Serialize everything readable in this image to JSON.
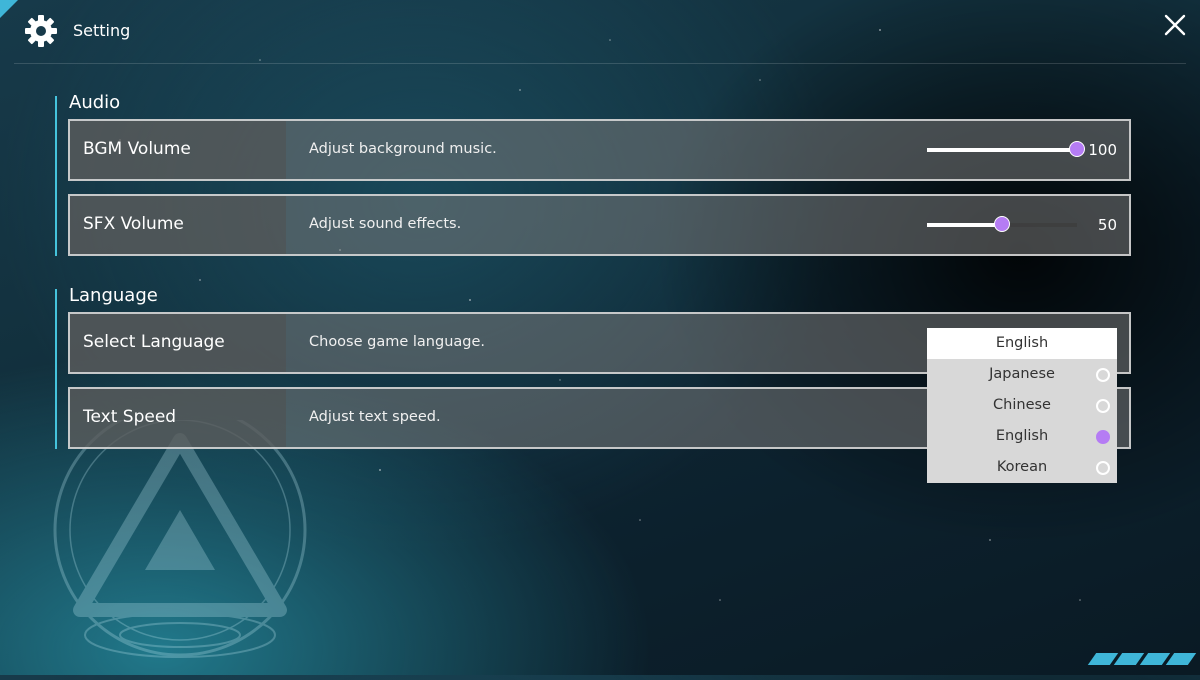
{
  "header": {
    "title": "Setting",
    "settings_icon": "gear-icon",
    "close_icon": "close-icon"
  },
  "sections": {
    "audio": {
      "title": "Audio",
      "bgm": {
        "label": "BGM Volume",
        "description": "Adjust background music.",
        "value": 100,
        "value_text": "100"
      },
      "sfx": {
        "label": "SFX Volume",
        "description": "Adjust sound effects.",
        "value": 50,
        "value_text": "50"
      }
    },
    "language": {
      "title": "Language",
      "select_language": {
        "label": "Select Language",
        "description": "Choose game language.",
        "selected": "English",
        "options": [
          {
            "label": "Japanese",
            "checked": false
          },
          {
            "label": "Chinese",
            "checked": false
          },
          {
            "label": "English",
            "checked": true
          },
          {
            "label": "Korean",
            "checked": false
          }
        ]
      },
      "text_speed": {
        "label": "Text Speed",
        "description": "Adjust text speed."
      }
    }
  },
  "colors": {
    "accent": "#b57cf4",
    "section_bar": "#45c3dc",
    "corner": "#3fb6d8"
  }
}
